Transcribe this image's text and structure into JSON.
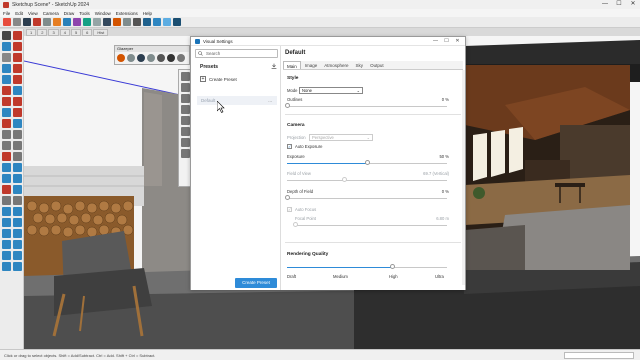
{
  "app": {
    "title": "Sketchup Scene* - SketchUp 2024",
    "window_controls": [
      "—",
      "☐",
      "✕"
    ]
  },
  "menu": [
    "File",
    "Edit",
    "View",
    "Camera",
    "Draw",
    "Tools",
    "Window",
    "Extensions",
    "Help"
  ],
  "scene_tabs": [
    "1",
    "2",
    "3",
    "4",
    "5",
    "6",
    "Hist"
  ],
  "mini_panel": {
    "title": "Glazeper"
  },
  "status_bar": {
    "text": "Click or drag to select objects. Shift = Add/Subtract. Ctrl = Add. Shift + Ctrl = Subtract."
  },
  "visual_settings": {
    "window_title": "Visual Settings",
    "search_placeholder": "Search",
    "presets_heading": "Presets",
    "create_preset_label": "Create Preset",
    "preset_items": [
      {
        "label": "Default",
        "menu": "..."
      }
    ],
    "create_preset_button": "Create Preset",
    "panel_heading": "Default",
    "tabs": [
      "Main",
      "Image",
      "Atmosphere",
      "Sky",
      "Output"
    ],
    "active_tab": "Main",
    "style": {
      "title": "Style",
      "mode_label": "Mode",
      "mode_value": "None",
      "outlines_label": "Outlines",
      "outlines_value": "0 %",
      "outlines_fraction": 0.0
    },
    "camera": {
      "title": "Camera",
      "projection_label": "Projection",
      "projection_value": "Perspective",
      "auto_exposure_label": "Auto Exposure",
      "auto_exposure_checked": true,
      "exposure_label": "Exposure",
      "exposure_value": "50 %",
      "exposure_fraction": 0.5,
      "fov_label": "Field of View",
      "fov_value": "69.7 (Vertical)",
      "fov_fraction": 0.36,
      "dof_label": "Depth of Field",
      "dof_value": "0 %",
      "dof_fraction": 0.0,
      "auto_focus_label": "Auto Focus",
      "auto_focus_checked": true,
      "focal_point_label": "Focal Point",
      "focal_point_value": "6.80 m",
      "focal_fraction": 0.0
    },
    "rendering_quality": {
      "title": "Rendering Quality",
      "levels": [
        "Draft",
        "Medium",
        "High",
        "Ultra"
      ],
      "fraction": 0.66
    }
  },
  "colors": {
    "accent": "#2e8bd8",
    "app_icon": "#c0392b"
  }
}
